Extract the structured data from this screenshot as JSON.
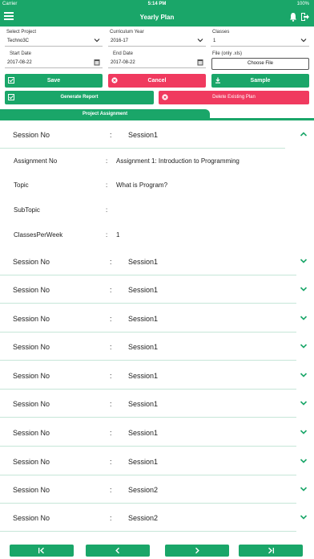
{
  "status": {
    "carrier": "Carrier",
    "time": "5:14 PM",
    "battery": "100%"
  },
  "nav": {
    "title": "Yearly Plan"
  },
  "form": {
    "project_label": "Select Project",
    "project_value": "Techno3C",
    "year_label": "Curriculum Year",
    "year_value": "2016-17",
    "classes_label": "Classes",
    "classes_value": "1",
    "start_label": "Start Date",
    "start_value": "2017-08-22",
    "end_label": "End Date",
    "end_value": "2017-08-22",
    "file_label": "File (only .xls)",
    "choose_label": "Choose File"
  },
  "buttons": {
    "save": "Save",
    "cancel": "Cancel",
    "sample": "Sample",
    "generate": "Generate Report",
    "delete": "Delete Existing Plan"
  },
  "tab": {
    "label": "Project Assignment"
  },
  "sessions": [
    {
      "key": "Session No",
      "value": "Session1",
      "expanded": true
    },
    {
      "key": "Session No",
      "value": "Session1"
    },
    {
      "key": "Session No",
      "value": "Session1"
    },
    {
      "key": "Session No",
      "value": "Session1"
    },
    {
      "key": "Session No",
      "value": "Session1"
    },
    {
      "key": "Session No",
      "value": "Session1"
    },
    {
      "key": "Session No",
      "value": "Session1"
    },
    {
      "key": "Session No",
      "value": "Session1"
    },
    {
      "key": "Session No",
      "value": "Session1"
    },
    {
      "key": "Session No",
      "value": "Session2"
    }
  ],
  "details": [
    {
      "key": "Assignment No",
      "value": "Assignment 1: Introduction to Programming"
    },
    {
      "key": "Topic",
      "value": "What is Program?"
    },
    {
      "key": "SubTopic",
      "value": ""
    },
    {
      "key": "ClassesPerWeek",
      "value": "1"
    }
  ],
  "colon": ":",
  "colors": {
    "primary": "#1aa669",
    "danger": "#f03a5f"
  }
}
